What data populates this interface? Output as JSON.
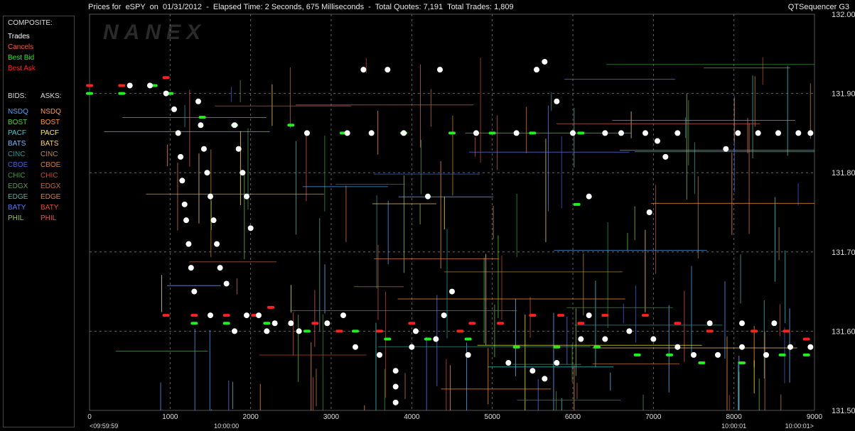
{
  "header": {
    "title": "Prices for  eSPY  on  01/31/2012  -  Elapsed Time: 2 Seconds, 675 Milliseconds  -  Total Quotes: 7,191  Total Trades: 1,809",
    "app": "QTSequencer G3"
  },
  "watermark": "NANEX",
  "legend": {
    "composite_heading": "COMPOSITE:",
    "composite": [
      {
        "label": "Trades",
        "color": "#ffffff"
      },
      {
        "label": "Cancels",
        "color": "#ff5a3c"
      },
      {
        "label": "Best Bid",
        "color": "#22ee22"
      },
      {
        "label": "Best Ask",
        "color": "#ff2020"
      }
    ],
    "bids_heading": "BIDS:",
    "asks_heading": "ASKS:",
    "exchanges": [
      {
        "bid": "NSDQ",
        "ask": "NSDQ",
        "bid_color": "#4aa8ff",
        "ask_color": "#ff9a3a"
      },
      {
        "bid": "BOST",
        "ask": "BOST",
        "bid_color": "#5acc3a",
        "ask_color": "#ff9a3a"
      },
      {
        "bid": "PACF",
        "ask": "PACF",
        "bid_color": "#3ad0d0",
        "ask_color": "#ffee44"
      },
      {
        "bid": "BATS",
        "ask": "BATS",
        "bid_color": "#7ab8ff",
        "ask_color": "#ffd070"
      },
      {
        "bid": "CINC",
        "ask": "CINC",
        "bid_color": "#2a9a9a",
        "ask_color": "#bb8844"
      },
      {
        "bid": "CBOE",
        "ask": "CBOE",
        "bid_color": "#3a60d8",
        "ask_color": "#d08030"
      },
      {
        "bid": "CHIC",
        "ask": "CHIC",
        "bid_color": "#3a9a3a",
        "ask_color": "#c04a2a"
      },
      {
        "bid": "EDGX",
        "ask": "EDGX",
        "bid_color": "#5a9a5a",
        "ask_color": "#c06a40"
      },
      {
        "bid": "EDGE",
        "ask": "EDGE",
        "bid_color": "#5ab0a0",
        "ask_color": "#e07a40"
      },
      {
        "bid": "BATY",
        "ask": "BATY",
        "bid_color": "#5a7aff",
        "ask_color": "#e04a3a"
      },
      {
        "bid": "PHIL",
        "ask": "PHIL",
        "bid_color": "#9ac05a",
        "ask_color": "#e05a5a"
      }
    ]
  },
  "chart_data": {
    "type": "scatter",
    "xlabel": "",
    "ylabel": "",
    "xlim": [
      0,
      9000
    ],
    "ylim": [
      131.5,
      132.0
    ],
    "x_ticks": [
      0,
      1000,
      2000,
      3000,
      4000,
      5000,
      6000,
      7000,
      8000,
      9000
    ],
    "y_ticks": [
      "131.50",
      "131.60",
      "131.70",
      "131.80",
      "131.90",
      "132.00"
    ],
    "time_labels": [
      {
        "x": 0,
        "label": "<09:59:59"
      },
      {
        "x": 1700,
        "label": "10:00:00"
      },
      {
        "x": 8000,
        "label": "10:00:01"
      },
      {
        "x": 8990,
        "label": "10:00:01>"
      }
    ],
    "grid": true,
    "series": [
      {
        "name": "Best Ask",
        "color": "#ff2020",
        "points": [
          [
            0,
            131.91
          ],
          [
            400,
            131.91
          ],
          [
            800,
            131.91
          ],
          [
            950,
            131.92
          ],
          [
            950,
            131.62
          ],
          [
            1300,
            131.62
          ],
          [
            1700,
            131.62
          ],
          [
            2050,
            131.62
          ],
          [
            2250,
            131.63
          ],
          [
            2800,
            131.61
          ],
          [
            3100,
            131.6
          ],
          [
            3600,
            131.6
          ],
          [
            4000,
            131.61
          ],
          [
            4600,
            131.6
          ],
          [
            4750,
            131.61
          ],
          [
            5100,
            131.61
          ],
          [
            5500,
            131.62
          ],
          [
            5850,
            131.62
          ],
          [
            6100,
            131.61
          ],
          [
            6400,
            131.62
          ],
          [
            6900,
            131.62
          ],
          [
            7300,
            131.61
          ],
          [
            7700,
            131.6
          ],
          [
            8250,
            131.6
          ],
          [
            8650,
            131.6
          ],
          [
            8900,
            131.59
          ]
        ]
      },
      {
        "name": "Best Bid",
        "color": "#22ee22",
        "points": [
          [
            0,
            131.9
          ],
          [
            400,
            131.9
          ],
          [
            800,
            131.91
          ],
          [
            1000,
            131.9
          ],
          [
            1400,
            131.87
          ],
          [
            1800,
            131.86
          ],
          [
            2500,
            131.86
          ],
          [
            3150,
            131.85
          ],
          [
            3900,
            131.85
          ],
          [
            4500,
            131.85
          ],
          [
            5000,
            131.85
          ],
          [
            5500,
            131.85
          ],
          [
            6100,
            131.85
          ],
          [
            6050,
            131.76
          ],
          [
            1300,
            131.61
          ],
          [
            1700,
            131.61
          ],
          [
            2200,
            131.61
          ],
          [
            2700,
            131.6
          ],
          [
            3300,
            131.6
          ],
          [
            3700,
            131.59
          ],
          [
            4200,
            131.59
          ],
          [
            4700,
            131.59
          ],
          [
            5300,
            131.58
          ],
          [
            5800,
            131.58
          ],
          [
            6300,
            131.58
          ],
          [
            6800,
            131.57
          ],
          [
            7200,
            131.57
          ],
          [
            7600,
            131.56
          ],
          [
            8100,
            131.56
          ],
          [
            8600,
            131.57
          ],
          [
            8900,
            131.57
          ]
        ]
      },
      {
        "name": "Trades",
        "color": "#ffffff",
        "points": [
          [
            500,
            131.91
          ],
          [
            750,
            131.91
          ],
          [
            950,
            131.9
          ],
          [
            1050,
            131.88
          ],
          [
            1100,
            131.85
          ],
          [
            1130,
            131.82
          ],
          [
            1150,
            131.79
          ],
          [
            1180,
            131.76
          ],
          [
            1200,
            131.74
          ],
          [
            1230,
            131.71
          ],
          [
            1260,
            131.68
          ],
          [
            1300,
            131.65
          ],
          [
            1350,
            131.89
          ],
          [
            1380,
            131.86
          ],
          [
            1420,
            131.83
          ],
          [
            1460,
            131.8
          ],
          [
            1500,
            131.77
          ],
          [
            1540,
            131.74
          ],
          [
            1580,
            131.71
          ],
          [
            1620,
            131.68
          ],
          [
            1700,
            131.66
          ],
          [
            1800,
            131.86
          ],
          [
            1850,
            131.83
          ],
          [
            1900,
            131.8
          ],
          [
            1950,
            131.77
          ],
          [
            2000,
            131.73
          ],
          [
            1950,
            131.62
          ],
          [
            2100,
            131.62
          ],
          [
            2300,
            131.61
          ],
          [
            2600,
            131.6
          ],
          [
            2700,
            131.85
          ],
          [
            3200,
            131.85
          ],
          [
            3400,
            131.93
          ],
          [
            3500,
            131.85
          ],
          [
            3700,
            131.93
          ],
          [
            3900,
            131.85
          ],
          [
            4050,
            131.6
          ],
          [
            4200,
            131.77
          ],
          [
            4350,
            131.93
          ],
          [
            4500,
            131.65
          ],
          [
            4800,
            131.85
          ],
          [
            5300,
            131.85
          ],
          [
            5550,
            131.93
          ],
          [
            5650,
            131.94
          ],
          [
            5800,
            131.89
          ],
          [
            6000,
            131.85
          ],
          [
            6200,
            131.62
          ],
          [
            6400,
            131.85
          ],
          [
            6600,
            131.85
          ],
          [
            6900,
            131.85
          ],
          [
            7050,
            131.84
          ],
          [
            7150,
            131.82
          ],
          [
            7300,
            131.85
          ],
          [
            7900,
            131.83
          ],
          [
            8050,
            131.85
          ],
          [
            8300,
            131.85
          ],
          [
            8550,
            131.85
          ],
          [
            8800,
            131.85
          ],
          [
            8950,
            131.85
          ],
          [
            6200,
            131.77
          ],
          [
            6950,
            131.75
          ],
          [
            3300,
            131.58
          ],
          [
            3600,
            131.57
          ],
          [
            3800,
            131.55
          ],
          [
            4000,
            131.58
          ],
          [
            4300,
            131.59
          ],
          [
            4700,
            131.57
          ],
          [
            5200,
            131.56
          ],
          [
            5500,
            131.55
          ],
          [
            5650,
            131.54
          ],
          [
            5800,
            131.56
          ],
          [
            6100,
            131.59
          ],
          [
            6400,
            131.59
          ],
          [
            6700,
            131.6
          ],
          [
            7000,
            131.59
          ],
          [
            7300,
            131.58
          ],
          [
            7500,
            131.57
          ],
          [
            7800,
            131.57
          ],
          [
            8100,
            131.58
          ],
          [
            8400,
            131.57
          ],
          [
            8700,
            131.58
          ],
          [
            8950,
            131.58
          ],
          [
            3800,
            131.51
          ],
          [
            3800,
            131.53
          ],
          [
            4400,
            131.62
          ],
          [
            2950,
            131.61
          ],
          [
            3150,
            131.62
          ],
          [
            7700,
            131.61
          ],
          [
            8100,
            131.61
          ],
          [
            8500,
            131.61
          ],
          [
            2500,
            131.61
          ],
          [
            2200,
            131.6
          ],
          [
            1800,
            131.6
          ],
          [
            1500,
            131.62
          ]
        ]
      }
    ]
  }
}
